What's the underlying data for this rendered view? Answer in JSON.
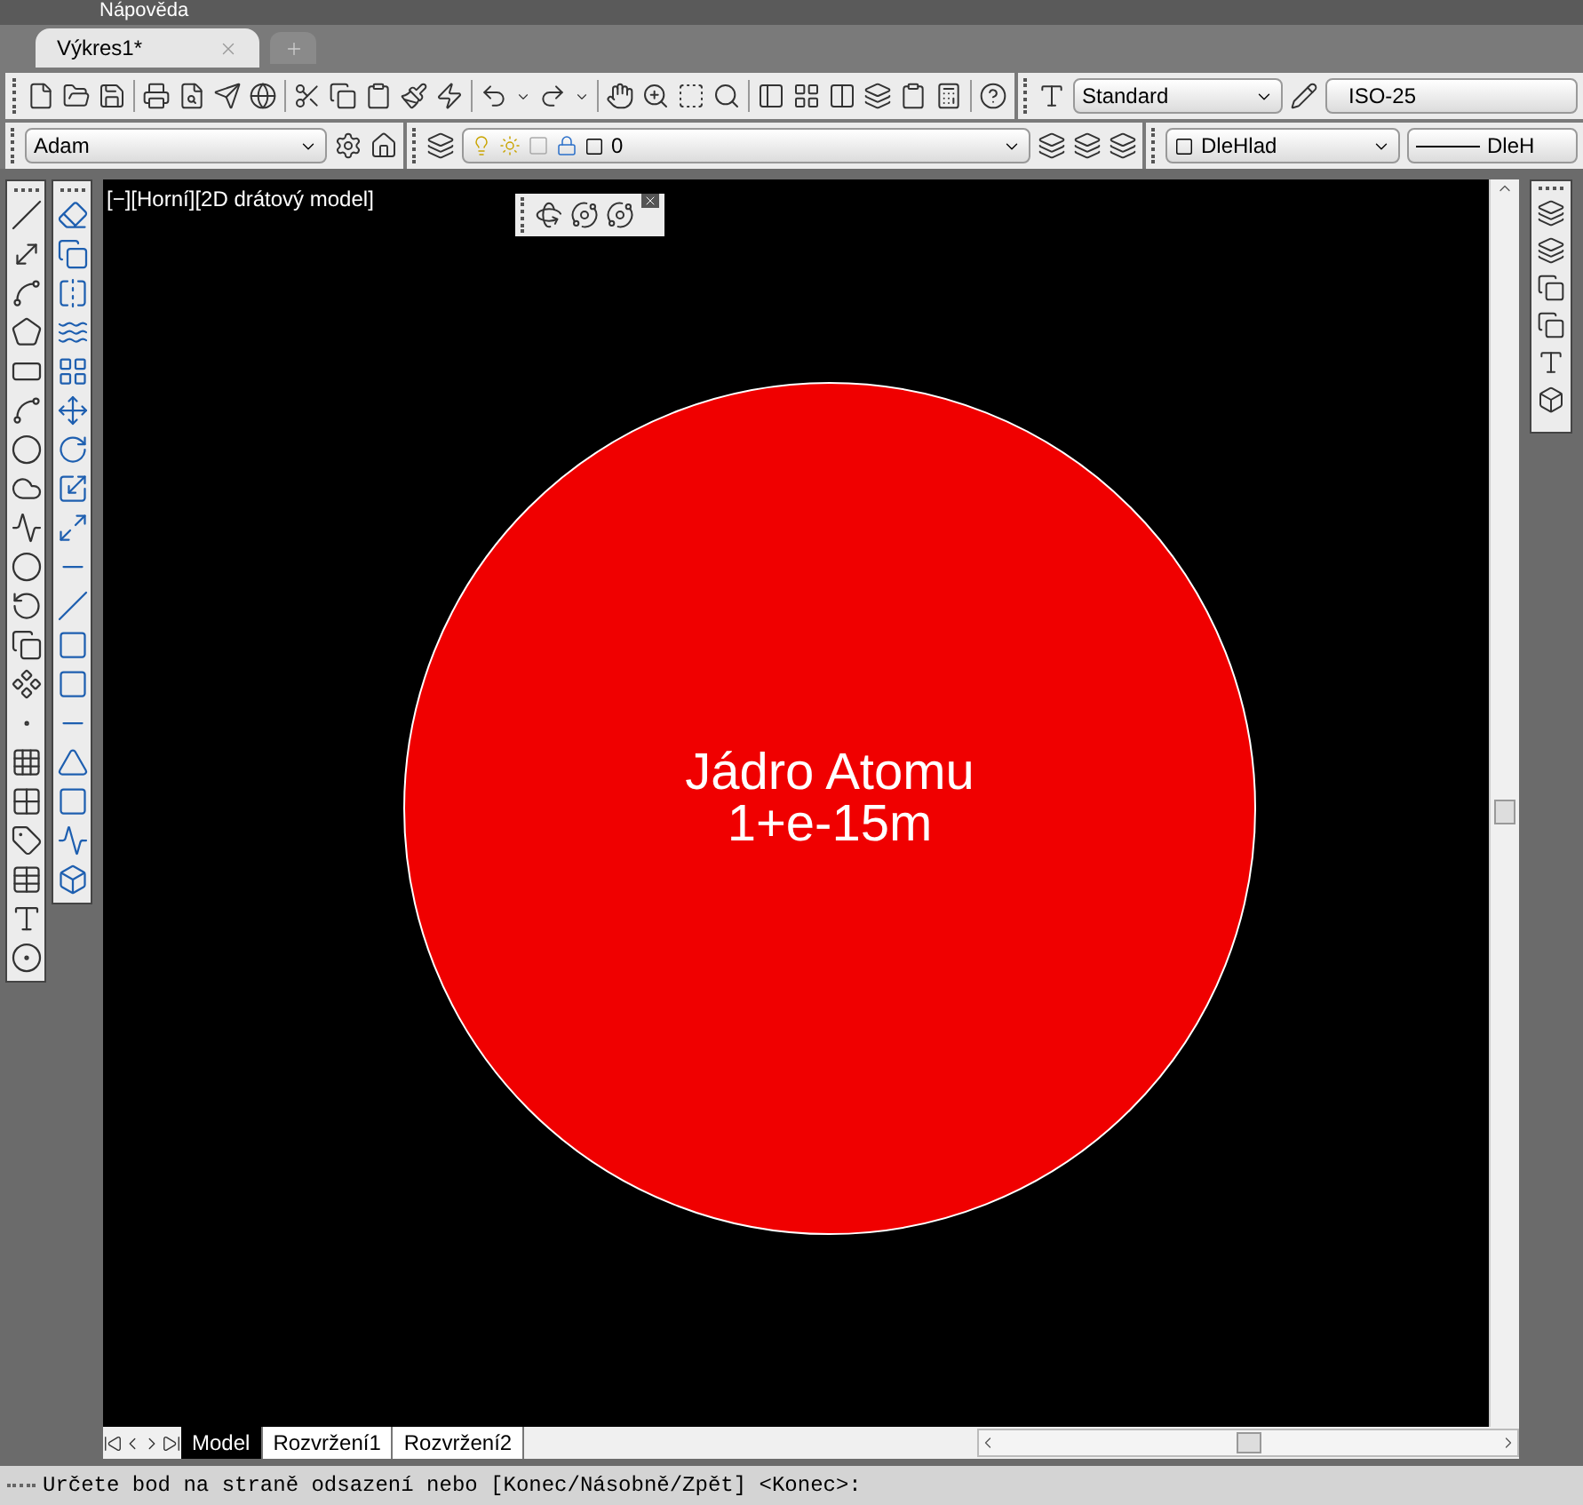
{
  "menu": {
    "label": "Nápověda"
  },
  "document_tabs": [
    {
      "label": "Výkres1*",
      "selected": true
    }
  ],
  "toolbars": {
    "workspace": "Adam",
    "layer": "0",
    "text_style": "Standard",
    "dim_style": "ISO-25",
    "color_setting": "DleHlad",
    "linetype": "DleH"
  },
  "viewport": {
    "label": "[−][Horní][2D drátový model]"
  },
  "drawing": {
    "labels": [
      "Jádro Atomu",
      "1+e-15m"
    ]
  },
  "layout_tabs": [
    {
      "label": "Model",
      "selected": true
    },
    {
      "label": "Rozvržení1",
      "selected": false
    },
    {
      "label": "Rozvržení2",
      "selected": false
    }
  ],
  "command_line": {
    "text": "Určete bod na straně odsazení nebo [Konec/Násobně/Zpět] <Konec>:"
  }
}
